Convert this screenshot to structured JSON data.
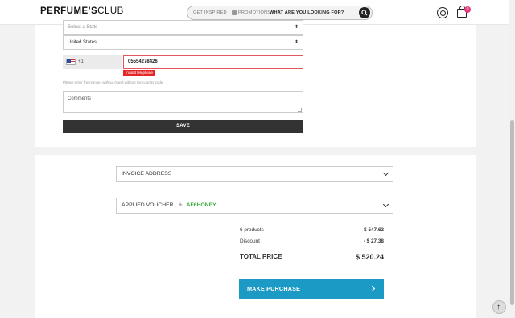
{
  "header": {
    "logo_main": "PERFUME'S",
    "logo_club": "CLUB",
    "nav_inspired": "GET INSPIRED",
    "nav_promotions": "PROMOTIONS",
    "search_placeholder": "WHAT ARE YOU LOOKING FOR?",
    "cart_count": "0"
  },
  "form": {
    "state_placeholder": "Select a State",
    "country_value": "United States",
    "phone_prefix": "+1",
    "phone_value": "05554278426",
    "phone_error": "Invalid telephone",
    "phone_hint": "Please enter the number without 0 and without the country code.",
    "comments_placeholder": "Comments",
    "save_label": "SAVE"
  },
  "checkout": {
    "invoice_label": "INVOICE ADDRESS",
    "voucher_label": "APPLIED VOUCHER",
    "voucher_code": "AF6HONEY",
    "products_label": "6 products",
    "products_value": "$ 547.62",
    "discount_label": "Discount",
    "discount_value": "- $ 27.38",
    "total_label": "TOTAL PRICE",
    "total_value": "$ 520.24",
    "purchase_label": "MAKE PURCHASE"
  },
  "colors": {
    "accent": "#1b9ac6",
    "error": "#e32626",
    "voucher": "#3bab3b",
    "badge": "#e2397a"
  }
}
